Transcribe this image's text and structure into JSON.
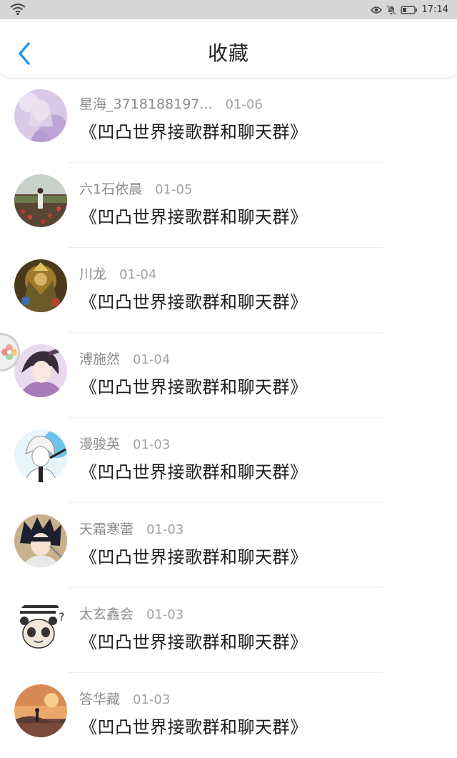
{
  "status_bar": {
    "time": "17:14",
    "icons": [
      "wifi-icon",
      "eye-icon",
      "mute-bell-icon",
      "battery-icon"
    ]
  },
  "header": {
    "title": "收藏",
    "back_icon": "chevron-left-icon",
    "accent_color": "#2196f3"
  },
  "favorites": [
    {
      "name": "星海_3718188197...",
      "date": "01-06",
      "title": "《凹凸世界接歌群和聊天群》",
      "avatar": "anime-girl-purple-avatar"
    },
    {
      "name": "六1石依晨",
      "date": "01-05",
      "title": "《凹凸世界接歌群和聊天群》",
      "avatar": "flower-field-photo-avatar"
    },
    {
      "name": "川龙",
      "date": "01-04",
      "title": "《凹凸世界接歌群和聊天群》",
      "avatar": "game-character-avatar"
    },
    {
      "name": "溥施然",
      "date": "01-04",
      "title": "《凹凸世界接歌群和聊天群》",
      "avatar": "anime-boy-purple-avatar"
    },
    {
      "name": "漫骏英",
      "date": "01-03",
      "title": "《凹凸世界接歌群和聊天群》",
      "avatar": "white-hair-anime-avatar"
    },
    {
      "name": "天霜寒蕾",
      "date": "01-03",
      "title": "《凹凸世界接歌群和聊天群》",
      "avatar": "ninja-anime-avatar"
    },
    {
      "name": "太玄鑫会",
      "date": "01-03",
      "title": "《凹凸世界接歌群和聊天群》",
      "avatar": "panda-meme-avatar"
    },
    {
      "name": "答华藏",
      "date": "01-03",
      "title": "《凹凸世界接歌群和聊天群》",
      "avatar": "sunset-illustration-avatar"
    }
  ]
}
